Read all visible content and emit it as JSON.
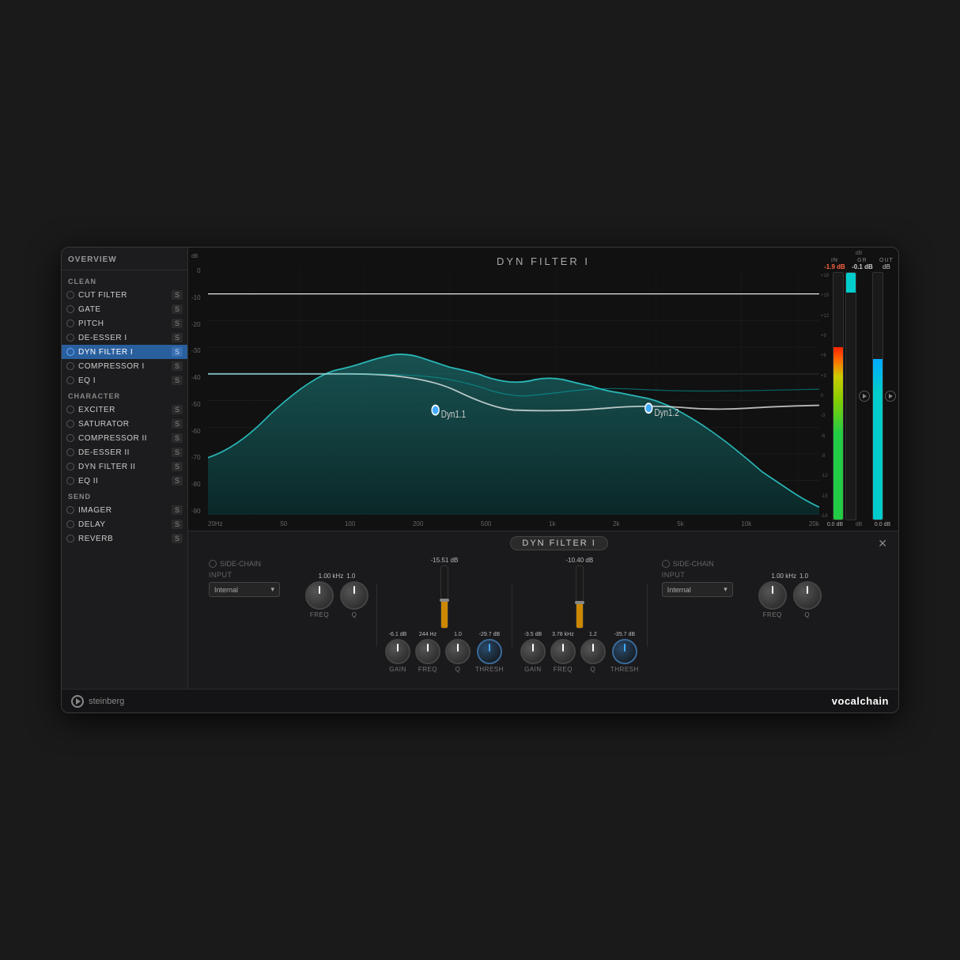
{
  "plugin": {
    "title": "vocalchain",
    "brand": "steinberg",
    "footer_brand": "steinberg",
    "footer_product_plain": "vocal",
    "footer_product_bold": "chain"
  },
  "sidebar": {
    "overview_label": "OVERVIEW",
    "sections": [
      {
        "label": "CLEAN",
        "items": [
          {
            "name": "CUT FILTER",
            "has_s": true,
            "active": false
          },
          {
            "name": "GATE",
            "has_s": true,
            "active": false
          },
          {
            "name": "PITCH",
            "has_s": true,
            "active": false
          },
          {
            "name": "DE-ESSER I",
            "has_s": true,
            "active": false
          },
          {
            "name": "DYN FILTER I",
            "has_s": true,
            "active": true
          },
          {
            "name": "COMPRESSOR I",
            "has_s": true,
            "active": false
          },
          {
            "name": "EQ I",
            "has_s": true,
            "active": false
          }
        ]
      },
      {
        "label": "CHARACTER",
        "items": [
          {
            "name": "EXCITER",
            "has_s": true,
            "active": false
          },
          {
            "name": "SATURATOR",
            "has_s": true,
            "active": false
          },
          {
            "name": "COMPRESSOR II",
            "has_s": true,
            "active": false
          },
          {
            "name": "DE-ESSER II",
            "has_s": true,
            "active": false
          },
          {
            "name": "DYN FILTER II",
            "has_s": true,
            "active": false
          },
          {
            "name": "EQ II",
            "has_s": true,
            "active": false
          }
        ]
      },
      {
        "label": "SEND",
        "items": [
          {
            "name": "IMAGER",
            "has_s": true,
            "active": false
          },
          {
            "name": "DELAY",
            "has_s": true,
            "active": false
          },
          {
            "name": "REVERB",
            "has_s": true,
            "active": false
          }
        ]
      }
    ]
  },
  "spectrum": {
    "title": "DYN FILTER I",
    "db_labels": [
      "0",
      "-10",
      "-20",
      "-30",
      "-40",
      "-50",
      "-60",
      "-70",
      "-80",
      "-90"
    ],
    "freq_labels": [
      "20Hz",
      "50",
      "100",
      "200",
      "500",
      "1k",
      "2k",
      "5k",
      "10k",
      "20k"
    ],
    "dyn1_label": "Dyn1.1",
    "dyn2_label": "Dyn1.2"
  },
  "meters": {
    "in_label": "IN",
    "gr_label": "GR",
    "out_label": "OUT",
    "in_value": "-1.9 dB",
    "gr_value": "-0.1 dB",
    "out_value": "0.0 dB",
    "in_bottom": "0.0 dB",
    "out_bottom": "0.0 dB",
    "db_top": "+18",
    "db_scale": [
      "+18",
      "+15",
      "+12",
      "+9",
      "+6",
      "+3",
      "0",
      "-3",
      "-6",
      "-9",
      "-12",
      "-15",
      "-18"
    ]
  },
  "bottom": {
    "title": "DYN FILTER I",
    "close_btn": "✕",
    "side_chain_label": "SIDE-CHAIN",
    "input_label": "INPUT",
    "input_value": "Internal",
    "dyn1": {
      "freq_value": "1.00 kHz",
      "q_value": "1.0",
      "gain_value": "-6.1 dB",
      "gain_freq": "244 Hz",
      "gain_q": "1.0",
      "thresh_value": "-29.7 dB"
    },
    "dyn2": {
      "gain_value": "-3.5 dB",
      "freq_value": "3.78 kHz",
      "q_value": "1.2",
      "thresh_value": "-35.7 dB"
    },
    "fader1_value": "-15.51 dB",
    "fader2_value": "-10.40 dB",
    "right_freq": "1.00 kHz",
    "right_q": "1.0"
  }
}
